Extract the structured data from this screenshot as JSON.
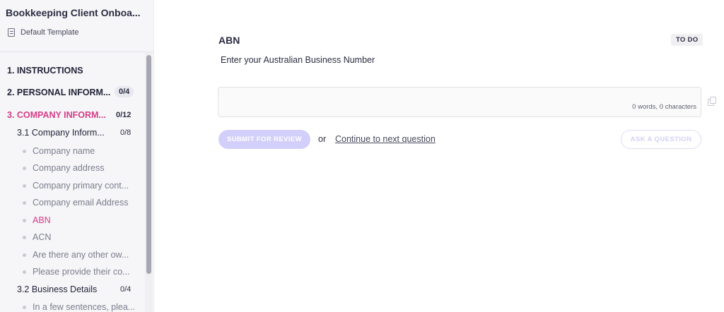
{
  "sidebar": {
    "title": "Bookkeeping Client Onboa...",
    "template_label": "Default Template",
    "items": [
      {
        "kind": "section",
        "label": "1. INSTRUCTIONS",
        "count": "",
        "active": false
      },
      {
        "kind": "section",
        "label": "2. PERSONAL INFORM...",
        "count": "0/4",
        "active": false
      },
      {
        "kind": "section",
        "label": "3. COMPANY INFORM...",
        "count": "0/12",
        "active": true
      },
      {
        "kind": "sub",
        "label": "3.1 Company Inform...",
        "count": "0/8",
        "active": false
      },
      {
        "kind": "leaf",
        "label": "Company name",
        "active": false
      },
      {
        "kind": "leaf",
        "label": "Company address",
        "active": false
      },
      {
        "kind": "leaf",
        "label": "Company primary cont...",
        "active": false
      },
      {
        "kind": "leaf",
        "label": "Company email Address",
        "active": false
      },
      {
        "kind": "leaf",
        "label": "ABN",
        "active": true
      },
      {
        "kind": "leaf",
        "label": "ACN",
        "active": false
      },
      {
        "kind": "leaf",
        "label": "Are there any other ow...",
        "active": false
      },
      {
        "kind": "leaf",
        "label": "Please provide their co...",
        "active": false
      },
      {
        "kind": "sub",
        "label": "3.2 Business Details",
        "count": "0/4",
        "active": false
      },
      {
        "kind": "leaf",
        "label": "In a few sentences, plea...",
        "active": false
      }
    ]
  },
  "question": {
    "title": "ABN",
    "status": "TO DO",
    "description": "Enter your Australian Business Number",
    "answer_value": "",
    "word_count": "0 words, 0 characters"
  },
  "actions": {
    "submit_label": "SUBMIT FOR REVIEW",
    "or_label": "or",
    "next_label": "Continue to next question",
    "ask_label": "ASK A QUESTION"
  },
  "colors": {
    "accent_pink": "#d63d87",
    "submit_bg": "#d2d0fb",
    "sidebar_bg": "#f6f6f8"
  }
}
